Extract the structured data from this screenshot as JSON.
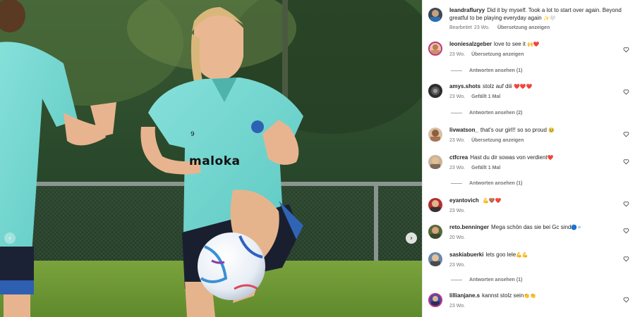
{
  "post": {
    "author": "leandrafluryy",
    "caption": "Did it by myself. Took a lot to start over again. Beyond greatful to be playing everyday again",
    "caption_emoji": "✨🤍",
    "edited_label": "Bearbeitet",
    "time": "23 Wo.",
    "translate": "Übersetzung anzeigen",
    "shirt_number": "9",
    "sponsor": "maloka"
  },
  "icons": {
    "next": "chevron-right-icon",
    "prev": "chevron-left-icon",
    "like": "heart-outline-icon"
  },
  "colors": {
    "jersey": "#6fd6d0",
    "username": "#262626",
    "meta": "#737373",
    "heart": "#e0245e"
  },
  "comments": [
    {
      "user": "leoniesalzgeber",
      "text": "love to see it",
      "emoji": "🙌❤️",
      "time": "23 Wo.",
      "action": "Übersetzung anzeigen",
      "replies": "Antworten ansehen (1)"
    },
    {
      "user": "amys.shots",
      "text": "stolz auf diii",
      "emoji": "❤️❤️❤️",
      "time": "23 Wo.",
      "action": "Gefällt 1 Mal",
      "replies": "Antworten ansehen (2)"
    },
    {
      "user": "livwatson_",
      "text": "that's our girl!! so so proud",
      "emoji": "🥹",
      "time": "23 Wo.",
      "action": "Übersetzung anzeigen",
      "replies": ""
    },
    {
      "user": "ctfcrea",
      "text": "Hast du dir sowas von verdient",
      "emoji": "❤️",
      "time": "23 Wo.",
      "action": "Gefällt 1 Mal",
      "replies": "Antworten ansehen (1)"
    },
    {
      "user": "eyantovich",
      "text": "",
      "emoji": "💪🤎❤️",
      "time": "23 Wo.",
      "action": "",
      "replies": ""
    },
    {
      "user": "reto.benninger",
      "text": "Mega schön das sie bei Gc sind",
      "emoji": "🔵⚪",
      "time": "20 Wo.",
      "action": "",
      "replies": ""
    },
    {
      "user": "saskiabuerki",
      "text": "lets goo lele",
      "emoji": "💪💪",
      "time": "23 Wo.",
      "action": "",
      "replies": "Antworten ansehen (1)"
    },
    {
      "user": "lillianjane.s",
      "text": "kannst stolz sein",
      "emoji": "👏👏",
      "time": "23 Wo.",
      "action": "",
      "replies": ""
    }
  ]
}
